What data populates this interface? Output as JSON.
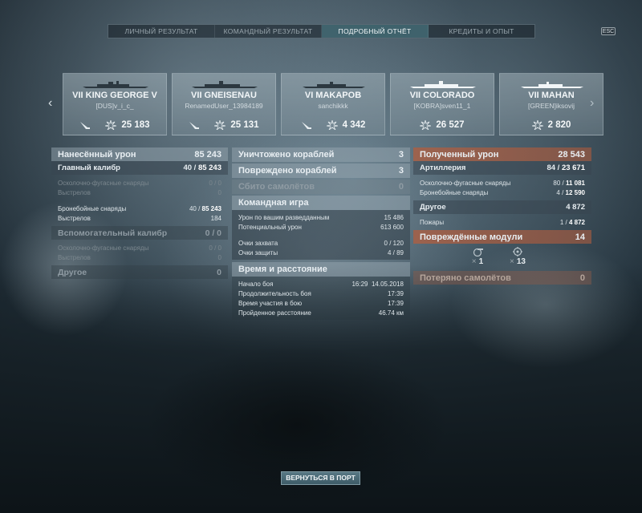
{
  "tabs": [
    {
      "label": "ЛИЧНЫЙ РЕЗУЛЬТАТ",
      "active": false
    },
    {
      "label": "КОМАНДНЫЙ РЕЗУЛЬТАТ",
      "active": false
    },
    {
      "label": "ПОДРОБНЫЙ ОТЧЁТ",
      "active": true
    },
    {
      "label": "КРЕДИТЫ И ОПЫТ",
      "active": false
    }
  ],
  "esc_label": "ESC",
  "nav": {
    "prev": "‹",
    "next": "›"
  },
  "ships": [
    {
      "name": "VII KING GEORGE V",
      "player": "[DUS]v_i_c_",
      "damage": "25 183",
      "icons": [
        "gun-icon",
        "explosion-icon"
      ]
    },
    {
      "name": "VII GNEISENAU",
      "player": "RenamedUser_13984189",
      "damage": "25 131",
      "icons": [
        "gun-icon",
        "explosion-icon"
      ]
    },
    {
      "name": "VI MAKAPOB",
      "player": "sanchikkk",
      "damage": "4 342",
      "icons": [
        "gun-icon",
        "explosion-icon"
      ]
    },
    {
      "name": "VII COLORADO",
      "player": "[KOBRA]sven11_1",
      "damage": "26 527",
      "icons": [
        "explosion-icon"
      ]
    },
    {
      "name": "VII MAHAN",
      "player": "[GREEN]iksovij",
      "damage": "2 820",
      "icons": [
        "explosion-icon"
      ]
    }
  ],
  "left": {
    "dealt_label": "Нанесённый урон",
    "dealt_value": "85 243",
    "main_label": "Главный калибр",
    "main_value_a": "40 /",
    "main_value_b": "85 243",
    "he_label": "Осколочно-фугасные снаряды",
    "he_value": "0 / 0",
    "he_shots_label": "Выстрелов",
    "he_shots_value": "0",
    "ap_label": "Бронебойные снаряды",
    "ap_value_a": "40 /",
    "ap_value_b": "85 243",
    "ap_shots_label": "Выстрелов",
    "ap_shots_value": "184",
    "secondary_label": "Вспомогательный калибр",
    "secondary_value": "0 / 0",
    "sec_he_label": "Осколочно-фугасные снаряды",
    "sec_he_value": "0 / 0",
    "sec_shots_label": "Выстрелов",
    "sec_shots_value": "0",
    "other_label": "Другое",
    "other_value": "0"
  },
  "middle": {
    "destroyed_label": "Уничтожено кораблей",
    "destroyed_value": "3",
    "damaged_label": "Повреждено кораблей",
    "damaged_value": "3",
    "planes_label": "Сбито самолётов",
    "planes_value": "0",
    "team_label": "Командная игра",
    "spotting_label": "Урон по вашим разведданным",
    "spotting_value": "15 486",
    "potential_label": "Потенциальный урон",
    "potential_value": "613 600",
    "capture_label": "Очки захвата",
    "capture_value": "0 / 120",
    "defense_label": "Очки защиты",
    "defense_value": "4 / 89",
    "time_label": "Время и расстояние",
    "start_label": "Начало боя",
    "start_value": "16:29  14.05.2018",
    "duration_label": "Продолжительность боя",
    "duration_value": "17:39",
    "participation_label": "Время участия в бою",
    "participation_value": "17:39",
    "distance_label": "Пройденное расстояние",
    "distance_value": "46.74 км"
  },
  "right": {
    "received_label": "Полученный урон",
    "received_value": "28 543",
    "artillery_label": "Артиллерия",
    "artillery_value_a": "84 /",
    "artillery_value_b": "23 671",
    "he_label": "Осколочно-фугасные снаряды",
    "he_value_a": "80 /",
    "he_value_b": "11 081",
    "ap_label": "Бронебойные снаряды",
    "ap_value_a": "4 /",
    "ap_value_b": "12 590",
    "other_label": "Другое",
    "other_value": "4 872",
    "fires_label": "Пожары",
    "fires_value_a": "1 /",
    "fires_value_b": "4 872",
    "modules_label": "Повреждённые модули",
    "modules_value": "14",
    "module_counts": [
      {
        "icon": "turret-icon",
        "mult": "×",
        "count": "1"
      },
      {
        "icon": "engine-icon",
        "mult": "×",
        "count": "13"
      }
    ],
    "planes_lost_label": "Потеряно самолётов",
    "planes_lost_value": "0"
  },
  "return_button": "ВЕРНУТЬСЯ В ПОРТ"
}
